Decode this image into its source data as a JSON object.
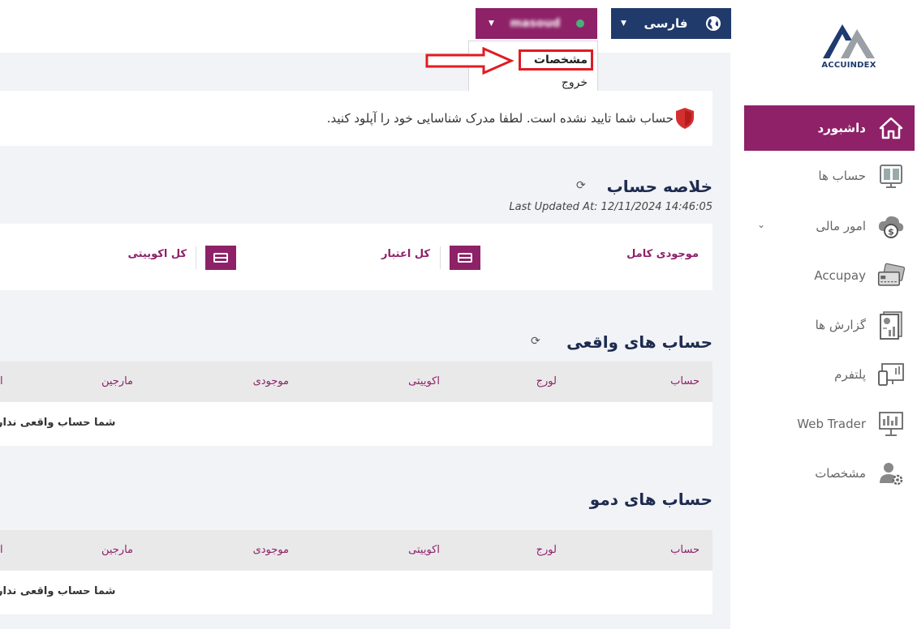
{
  "header": {
    "language_label": "فارسی",
    "user_name": "masoud",
    "user_menu": {
      "items": [
        "مشخصات",
        "خروج"
      ]
    }
  },
  "logo": {
    "text": "ACCUINDEX"
  },
  "sidebar": {
    "items": [
      {
        "label": "داشبورد",
        "icon": "home-icon",
        "active": true
      },
      {
        "label": "حساب ها",
        "icon": "accounts-icon"
      },
      {
        "label": "امور مالی",
        "icon": "finance-icon",
        "has_submenu": true
      },
      {
        "label": "Accupay",
        "icon": "cards-icon"
      },
      {
        "label": "گزارش ها",
        "icon": "report-icon"
      },
      {
        "label": "پلتفرم",
        "icon": "platform-icon"
      },
      {
        "label": "Web Trader",
        "icon": "webtrader-icon"
      },
      {
        "label": "مشخصات",
        "icon": "user-settings-icon"
      }
    ]
  },
  "alert": {
    "text": "حساب شما تایید نشده است. لطفا مدرک شناسایی خود را آپلود کنید."
  },
  "summary": {
    "title": "خلاصه حساب",
    "last_updated": "Last Updated At: 12/11/2024 14:46:05",
    "items": [
      "موجودی کامل",
      "کل اعتبار",
      "کل اکوییتی"
    ]
  },
  "real_accounts": {
    "title": "حساب های واقعی",
    "columns": [
      "حساب",
      "لورج",
      "اکوییتی",
      "موجودی",
      "مارجین",
      "ا"
    ],
    "empty_text": "شما حساب واقعی ندار"
  },
  "demo_accounts": {
    "title": "حساب های دمو",
    "columns": [
      "حساب",
      "لورج",
      "اکوییتی",
      "موجودی",
      "مارجین",
      "ا"
    ],
    "empty_text": "شما حساب واقعی ندار"
  },
  "colors": {
    "primary": "#8e2168",
    "navy": "#203a6b",
    "annotation": "#e11b22"
  }
}
